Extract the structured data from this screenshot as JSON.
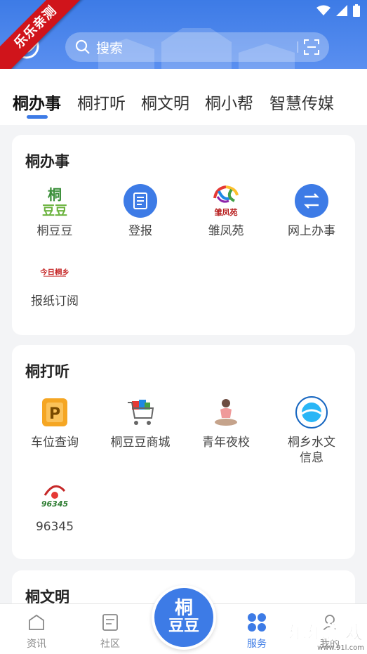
{
  "ribbon": "乐乐亲测",
  "search": {
    "placeholder": "搜索"
  },
  "tabs": [
    "桐办事",
    "桐打听",
    "桐文明",
    "桐小帮",
    "智慧传媒"
  ],
  "sections": [
    {
      "title": "桐办事",
      "items": [
        {
          "label": "桐豆豆",
          "icon": "tongdoudou-logo-icon"
        },
        {
          "label": "登报",
          "icon": "newspaper-icon"
        },
        {
          "label": "雏凤苑",
          "icon": "chufengyuan-logo-icon"
        },
        {
          "label": "网上办事",
          "icon": "exchange-icon"
        },
        {
          "label": "报纸订阅",
          "icon": "jinritongxiang-logo-icon",
          "logo_text": "今日桐乡"
        }
      ]
    },
    {
      "title": "桐打听",
      "items": [
        {
          "label": "车位查询",
          "icon": "parking-icon"
        },
        {
          "label": "桐豆豆商城",
          "icon": "shopping-cart-icon"
        },
        {
          "label": "青年夜校",
          "icon": "yoga-figure-icon"
        },
        {
          "label": "桐乡水文信息",
          "label_lines": [
            "桐乡水文",
            "信息"
          ],
          "icon": "hydrology-logo-icon"
        },
        {
          "label": "96345",
          "icon": "96345-logo-icon",
          "logo_text": "96345"
        }
      ]
    },
    {
      "title": "桐文明"
    }
  ],
  "bottom_nav": [
    {
      "label": "资讯",
      "icon": "house-icon",
      "active": false
    },
    {
      "label": "社区",
      "icon": "document-icon",
      "active": false
    },
    {
      "label": "服务",
      "icon": "grid-icon",
      "active": true
    },
    {
      "label": "我的",
      "icon": "profile-icon",
      "active": false
    }
  ],
  "fab": {
    "line1": "桐",
    "line2": "豆豆"
  },
  "watermark": {
    "text": "乐乐游戏",
    "url": "www.91l.com"
  },
  "colors": {
    "primary": "#3d7be6",
    "ribbon": "#d0141b"
  }
}
